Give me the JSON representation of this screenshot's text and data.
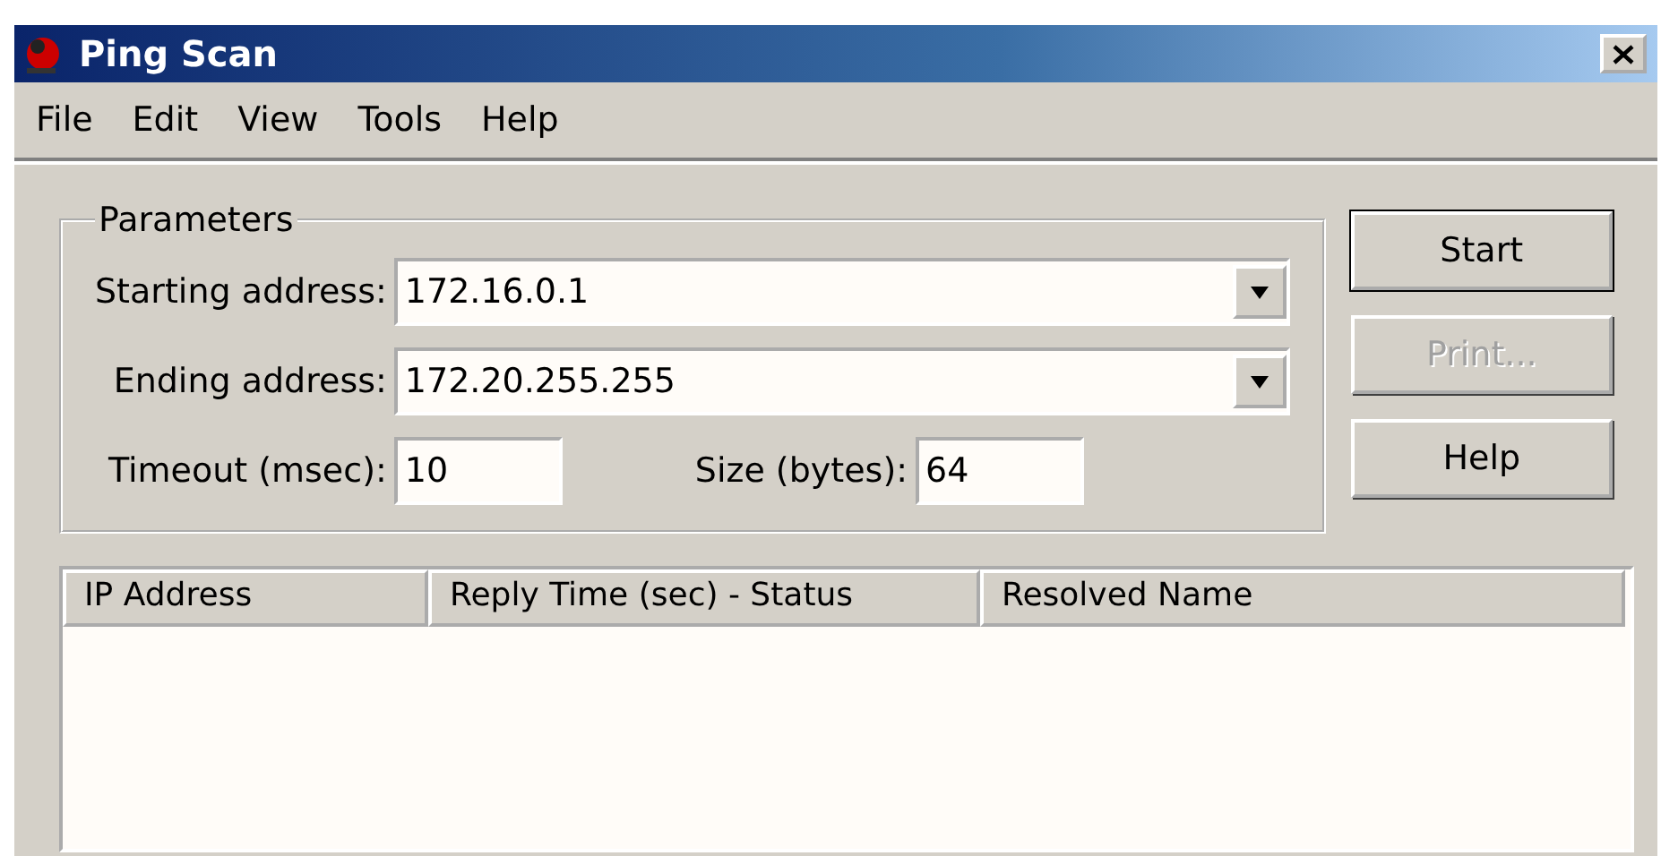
{
  "window": {
    "title": "Ping Scan"
  },
  "menu": [
    {
      "label": "File"
    },
    {
      "label": "Edit"
    },
    {
      "label": "View"
    },
    {
      "label": "Tools"
    },
    {
      "label": "Help"
    }
  ],
  "parameters": {
    "title": "Parameters",
    "starting_address": {
      "label": "Starting address:",
      "value": "172.16.0.1"
    },
    "ending_address": {
      "label": "Ending address:",
      "value": "172.20.255.255"
    },
    "timeout": {
      "label": "Timeout (msec):",
      "value": "10"
    },
    "size": {
      "label": "Size (bytes):",
      "value": "64"
    }
  },
  "buttons": [
    {
      "label": "Start",
      "disabled": false
    },
    {
      "label": "Print...",
      "disabled": true
    },
    {
      "label": "Help",
      "disabled": false
    }
  ],
  "table": {
    "columns": [
      "IP Address",
      "Reply Time (sec) - Status",
      "Resolved Name"
    ]
  }
}
